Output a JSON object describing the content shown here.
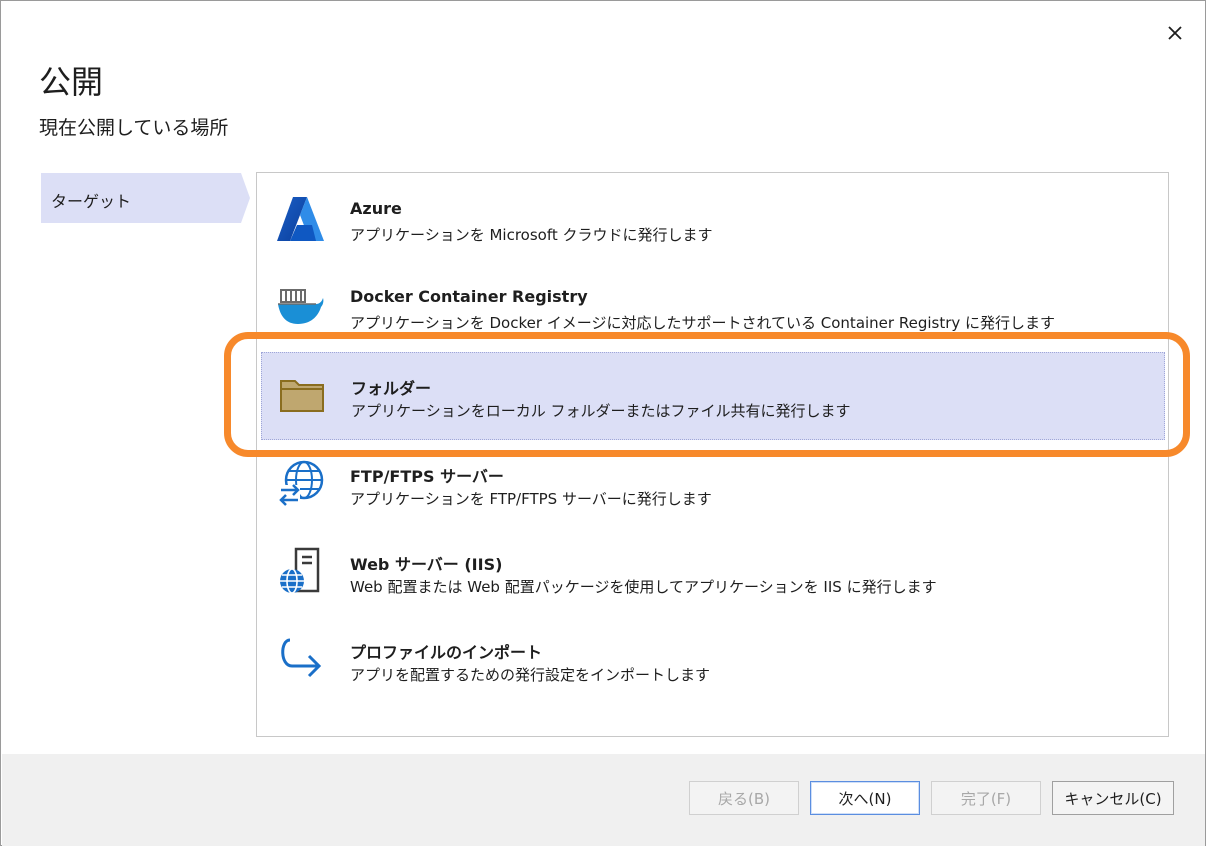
{
  "dialog": {
    "title": "公開",
    "subtitle": "現在公開している場所",
    "close_icon": "close-icon"
  },
  "nav": {
    "items": [
      {
        "label": "ターゲット",
        "selected": true
      }
    ]
  },
  "targets": [
    {
      "icon": "azure-icon",
      "name": "Azure",
      "description": "アプリケーションを Microsoft クラウドに発行します",
      "selected": false
    },
    {
      "icon": "docker-icon",
      "name": "Docker Container Registry",
      "description": "アプリケーションを Docker イメージに対応したサポートされている Container Registry に発行します",
      "selected": false
    },
    {
      "icon": "folder-icon",
      "name": "フォルダー",
      "description": "アプリケーションをローカル フォルダーまたはファイル共有に発行します",
      "selected": true
    },
    {
      "icon": "ftp-globe-icon",
      "name": "FTP/FTPS サーバー",
      "description": "アプリケーションを FTP/FTPS サーバーに発行します",
      "selected": false
    },
    {
      "icon": "web-server-icon",
      "name": "Web サーバー (IIS)",
      "description": "Web 配置または Web 配置パッケージを使用してアプリケーションを IIS に発行します",
      "selected": false
    },
    {
      "icon": "import-arrow-icon",
      "name": "プロファイルのインポート",
      "description": "アプリを配置するための発行設定をインポートします",
      "selected": false
    }
  ],
  "footer": {
    "back_label": "戻る(B)",
    "next_label": "次へ(N)",
    "finish_label": "完了(F)",
    "cancel_label": "キャンセル(C)"
  },
  "colors": {
    "selection": "#dcdff6",
    "highlight_outline": "#f7892b",
    "azure_blue": "#0078d4",
    "folder_fill": "#bfa76f",
    "folder_stroke": "#8a6d1f"
  }
}
